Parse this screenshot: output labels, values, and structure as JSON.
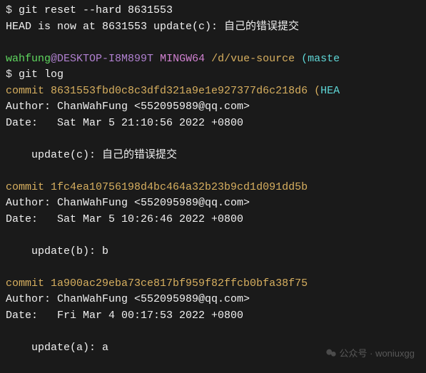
{
  "line1": {
    "dollar": "$ ",
    "cmd": "git reset --hard 8631553"
  },
  "line2": "HEAD is now at 8631553 update(c): 自己的错误提交",
  "prompt": {
    "user": "wahfung",
    "at": "@",
    "host": "DESKTOP-I8M899T",
    "space": " ",
    "mingw": "MINGW64",
    "space2": " ",
    "path": "/d/vue-source",
    "space3": " ",
    "branch": "(maste"
  },
  "line4": {
    "dollar": "$ ",
    "cmd": "git log"
  },
  "commit1": {
    "label": "commit ",
    "hash": "8631553fbd0c8c3dfd321a9e1e927377d6c218d6",
    "paren": " (",
    "ref": "HEA"
  },
  "author1": "Author: ChanWahFung <552095989@qq.com>",
  "date1": "Date:   Sat Mar 5 21:10:56 2022 +0800",
  "msg1": "    update(c): 自己的错误提交",
  "commit2": {
    "label": "commit ",
    "hash": "1fc4ea10756198d4bc464a32b23b9cd1d091dd5b"
  },
  "author2": "Author: ChanWahFung <552095989@qq.com>",
  "date2": "Date:   Sat Mar 5 10:26:46 2022 +0800",
  "msg2": "    update(b): b",
  "commit3": {
    "label": "commit ",
    "hash": "1a900ac29eba73ce817bf959f82ffcb0bfa38f75"
  },
  "author3": "Author: ChanWahFung <552095989@qq.com>",
  "date3": "Date:   Fri Mar 4 00:17:53 2022 +0800",
  "msg3": "    update(a): a",
  "watermark": "公众号 · woniuxgg",
  "side_watermark": ""
}
